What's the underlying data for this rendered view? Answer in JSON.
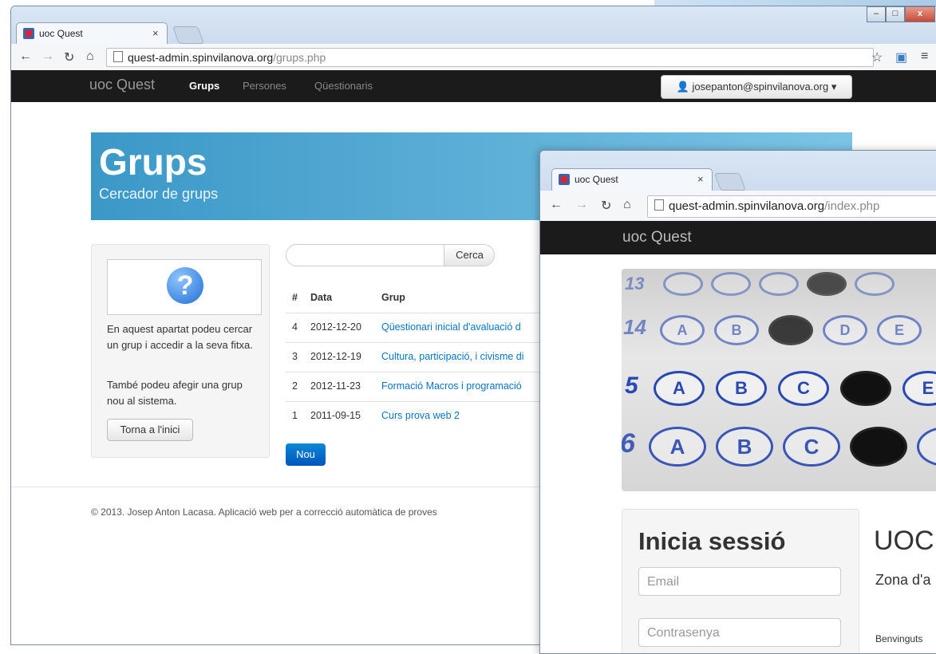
{
  "back_window": {
    "tab_title": "uoc Quest",
    "tab_close": "×",
    "url_domain": "quest-admin.spinvilanova.org",
    "url_path": "/grups.php",
    "window_buttons": [
      "–",
      "□",
      "x"
    ],
    "brand": "uoc Quest",
    "nav": [
      "Grups",
      "Persones",
      "Qüestionaris"
    ],
    "user_menu": "josepanton@spinvilanova.org",
    "hero_title": "Grups",
    "hero_subtitle": "Cercador de grups",
    "help_icon": "?",
    "help_text_1": "En aquest apartat podeu cercar un grup i accedir a la seva fitxa.",
    "help_text_2": "També podeu afegir una grup nou al sistema.",
    "back_button": "Torna a l'inici",
    "search_placeholder": "",
    "search_button": "Cerca",
    "table_headers": [
      "#",
      "Data",
      "Grup"
    ],
    "rows": [
      {
        "id": "4",
        "date": "2012-12-20",
        "group": "Qüestionari inicial d'avaluació d"
      },
      {
        "id": "3",
        "date": "2012-12-19",
        "group": "Cultura, participació, i civisme di"
      },
      {
        "id": "2",
        "date": "2012-11-23",
        "group": "Formació Macros i programació"
      },
      {
        "id": "1",
        "date": "2011-09-15",
        "group": "Curs prova web 2"
      }
    ],
    "new_button": "Nou",
    "footer": "© 2013. Josep Anton Lacasa. Aplicació web per a correcció automàtica de proves"
  },
  "front_window": {
    "tab_title": "uoc Quest",
    "tab_close": "×",
    "url_domain": "quest-admin.spinvilanova.org",
    "url_path": "/index.php",
    "brand": "uoc Quest",
    "photo_rows": [
      {
        "label": "13",
        "bubbles": [
          "",
          "",
          "",
          "",
          "",
          ""
        ]
      },
      {
        "label": "14",
        "bubbles": [
          "A",
          "B",
          "",
          "D",
          "E"
        ]
      },
      {
        "label": "5",
        "bubbles": [
          "A",
          "B",
          "C",
          "",
          "E"
        ]
      },
      {
        "label": "6",
        "bubbles": [
          "A",
          "B",
          "C",
          "",
          "E"
        ]
      }
    ],
    "login_title": "Inicia sessió",
    "email_placeholder": "Email",
    "password_placeholder": "Contrasenya",
    "heading": "UOC",
    "subheading": "Zona d'a",
    "welcome": "Benvinguts"
  }
}
